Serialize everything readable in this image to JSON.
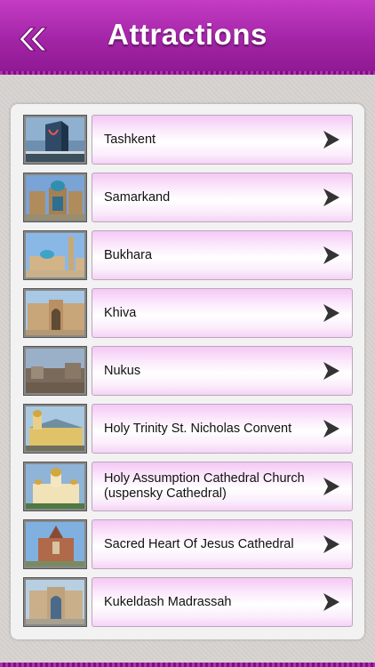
{
  "header": {
    "title": "Attractions",
    "back_icon": "double-chevron-left-icon",
    "color": "#a224a6"
  },
  "list": {
    "items": [
      {
        "label": "Tashkent",
        "thumb": "tashkent-photo",
        "row_icon": "chevron-right-icon"
      },
      {
        "label": "Samarkand",
        "thumb": "samarkand-photo",
        "row_icon": "chevron-right-icon"
      },
      {
        "label": "Bukhara",
        "thumb": "bukhara-photo",
        "row_icon": "chevron-right-icon"
      },
      {
        "label": "Khiva",
        "thumb": "khiva-photo",
        "row_icon": "chevron-right-icon"
      },
      {
        "label": "Nukus",
        "thumb": "nukus-photo",
        "row_icon": "chevron-right-icon"
      },
      {
        "label": "Holy Trinity St. Nicholas Convent",
        "thumb": "holy-trinity-photo",
        "row_icon": "chevron-right-icon"
      },
      {
        "label": "Holy Assumption Cathedral Church (uspensky Cathedral)",
        "thumb": "holy-assumption-photo",
        "row_icon": "chevron-right-icon"
      },
      {
        "label": "Sacred Heart Of Jesus Cathedral",
        "thumb": "sacred-heart-photo",
        "row_icon": "chevron-right-icon"
      },
      {
        "label": "Kukeldash Madrassah",
        "thumb": "kukeldash-photo",
        "row_icon": "chevron-right-icon"
      }
    ]
  }
}
